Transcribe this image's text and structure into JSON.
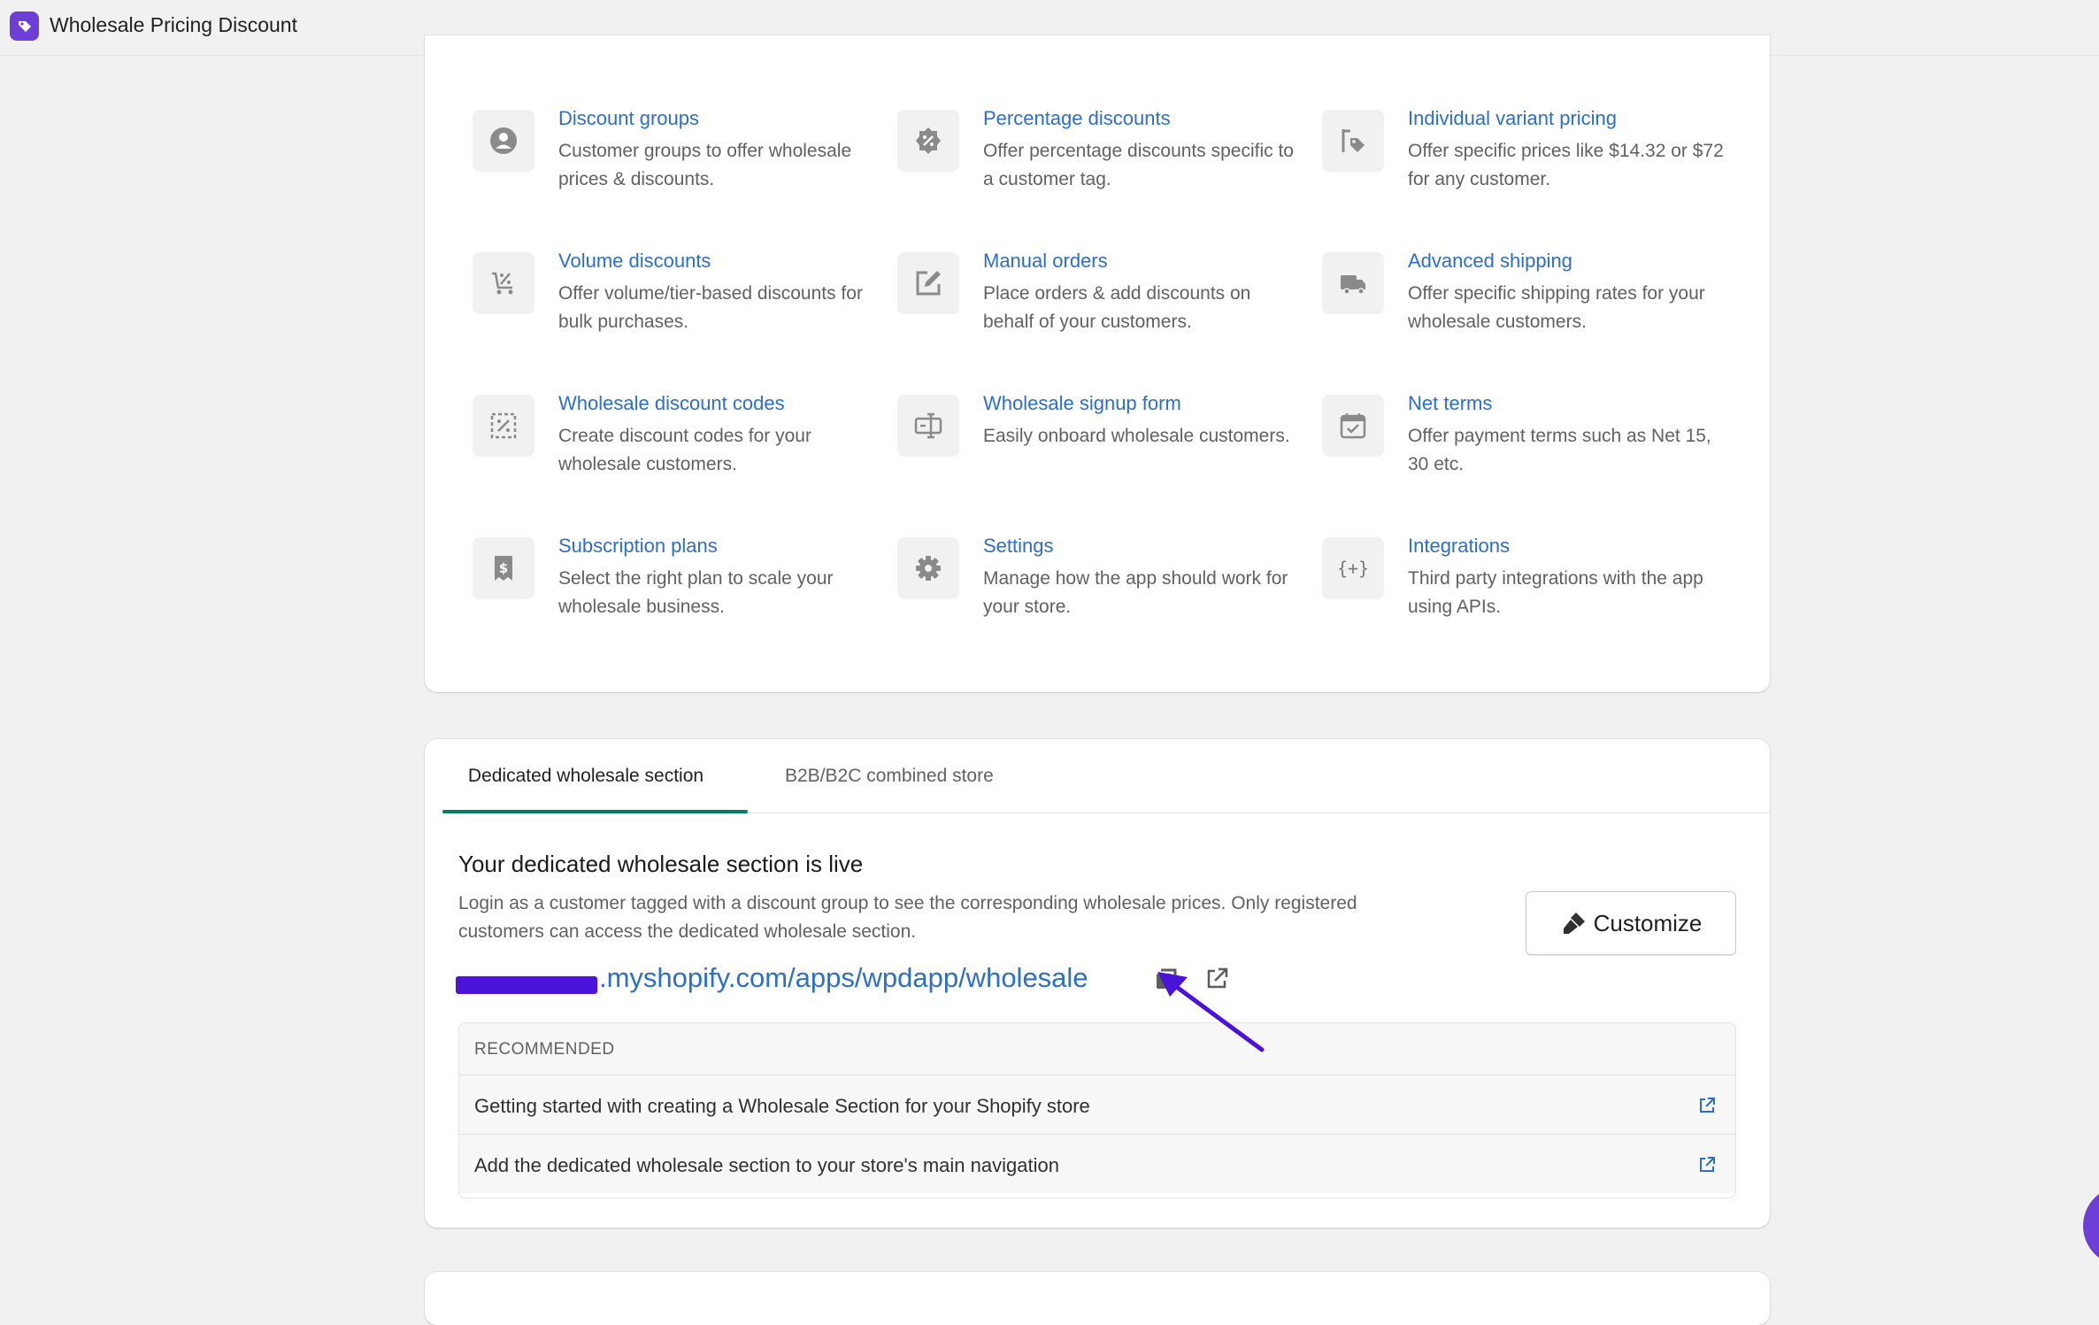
{
  "app": {
    "title": "Wholesale Pricing Discount"
  },
  "features": [
    {
      "title": "Discount groups",
      "desc": "Customer groups to offer wholesale prices & discounts.",
      "icon": "customer-icon"
    },
    {
      "title": "Percentage discounts",
      "desc": "Offer percentage discounts specific to a customer tag.",
      "icon": "discount-badge-icon"
    },
    {
      "title": "Individual variant pricing",
      "desc": "Offer specific prices like $14.32 or $72 for any customer.",
      "icon": "price-tag-icon"
    },
    {
      "title": "Volume discounts",
      "desc": "Offer volume/tier-based discounts for bulk purchases.",
      "icon": "cart-discount-icon"
    },
    {
      "title": "Manual orders",
      "desc": "Place orders & add discounts on behalf of your customers.",
      "icon": "edit-icon"
    },
    {
      "title": "Advanced shipping",
      "desc": "Offer specific shipping rates for your wholesale customers.",
      "icon": "truck-icon"
    },
    {
      "title": "Wholesale discount codes",
      "desc": "Create discount codes for your wholesale customers.",
      "icon": "discount-code-icon"
    },
    {
      "title": "Wholesale signup form",
      "desc": "Easily onboard wholesale customers.",
      "icon": "form-icon"
    },
    {
      "title": "Net terms",
      "desc": "Offer payment terms such as Net 15, 30 etc.",
      "icon": "calendar-icon"
    },
    {
      "title": "Subscription plans",
      "desc": "Select the right plan to scale your wholesale business.",
      "icon": "receipt-icon"
    },
    {
      "title": "Settings",
      "desc": "Manage how the app should work for your store.",
      "icon": "gear-icon"
    },
    {
      "title": "Integrations",
      "desc": "Third party integrations with the app using APIs.",
      "icon": "code-icon"
    }
  ],
  "tabs": [
    {
      "label": "Dedicated wholesale section",
      "active": true
    },
    {
      "label": "B2B/B2C combined store",
      "active": false
    }
  ],
  "section": {
    "title": "Your dedicated wholesale section is live",
    "description": "Login as a customer tagged with a discount group to see the corresponding wholesale prices. Only registered customers can access the dedicated wholesale section.",
    "url_suffix": ".myshopify.com/apps/wpdapp/wholesale",
    "customize_label": "Customize"
  },
  "recommended": {
    "header": "RECOMMENDED",
    "items": [
      "Getting started with creating a Wholesale Section for your Shopify store",
      "Add the dedicated wholesale section to your store's main navigation"
    ]
  },
  "colors": {
    "link": "#2c6ecb",
    "accent": "#6d3fd8",
    "tab_active": "#008060",
    "annotation_arrow": "#4b12d9"
  }
}
